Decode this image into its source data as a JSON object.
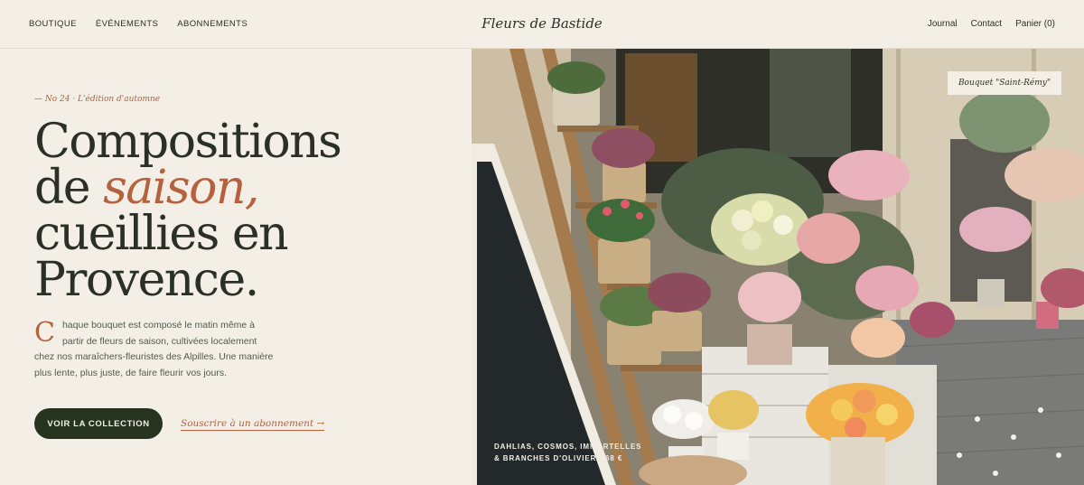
{
  "nav": {
    "left": [
      "BOUTIQUE",
      "ÉVÉNEMENTS",
      "ABONNEMENTS"
    ],
    "brand": "Fleurs de Bastide",
    "right": [
      "Journal",
      "Contact",
      "Panier (0)"
    ]
  },
  "hero": {
    "edition": "— No 24 · L'édition d'automne",
    "headline_line1": "Compositions",
    "headline_de": "de ",
    "headline_accent": "saison,",
    "headline_line3": "cueillies en",
    "headline_line4": "Provence.",
    "intro_dropcap": "C",
    "intro_text": "haque bouquet est composé le matin même à partir de fleurs de saison, cultivées localement chez nos maraîchers-fleuristes des Alpilles. Une manière plus lente, plus juste, de faire fleurir vos jours.",
    "cta_label": "VOIR LA COLLECTION",
    "subscribe_label": "Souscrire à un abonnement →"
  },
  "photo": {
    "tag": "Bouquet \"Saint-Rémy\"",
    "caption_line1": "DAHLIAS, COSMOS, IMMORTELLES",
    "caption_line2": "& BRANCHES D'OLIVIER · 68 €"
  },
  "colors": {
    "accent": "#b5613e",
    "dark_green": "#26331f",
    "background": "#f3efe6"
  }
}
